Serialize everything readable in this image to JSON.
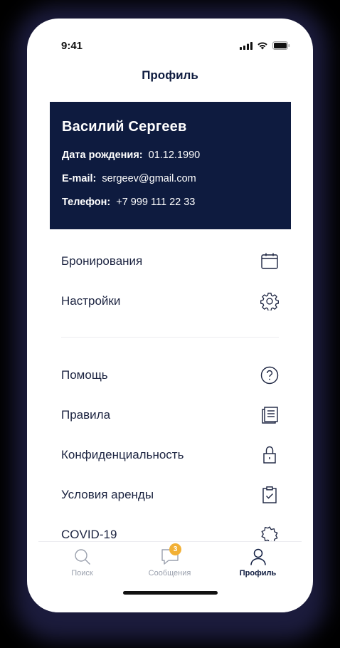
{
  "status_bar": {
    "time": "9:41"
  },
  "header": {
    "title": "Профиль"
  },
  "profile": {
    "name": "Василий Сергеев",
    "birth_label": "Дата рождения:",
    "birth_value": "01.12.1990",
    "email_label": "E-mail:",
    "email_value": "sergeev@gmail.com",
    "phone_label": "Телефон:",
    "phone_value": "+7 999 111 22 33"
  },
  "menu_top": [
    {
      "label": "Бронирования",
      "icon": "calendar-icon"
    },
    {
      "label": "Настройки",
      "icon": "gear-icon"
    }
  ],
  "menu_bottom": [
    {
      "label": "Помощь",
      "icon": "help-icon"
    },
    {
      "label": "Правила",
      "icon": "documents-icon"
    },
    {
      "label": "Конфиденциальность",
      "icon": "lock-icon"
    },
    {
      "label": "Условия аренды",
      "icon": "clipboard-check-icon"
    },
    {
      "label": "COVID-19",
      "icon": "virus-icon"
    }
  ],
  "tabs": [
    {
      "label": "Поиск",
      "icon": "search-icon"
    },
    {
      "label": "Сообщения",
      "icon": "chat-icon",
      "badge": "3"
    },
    {
      "label": "Профиль",
      "icon": "user-icon",
      "active": true
    }
  ],
  "colors": {
    "primary": "#0e1b3f",
    "badge": "#f2b035",
    "inactive": "#9aa0ad"
  }
}
